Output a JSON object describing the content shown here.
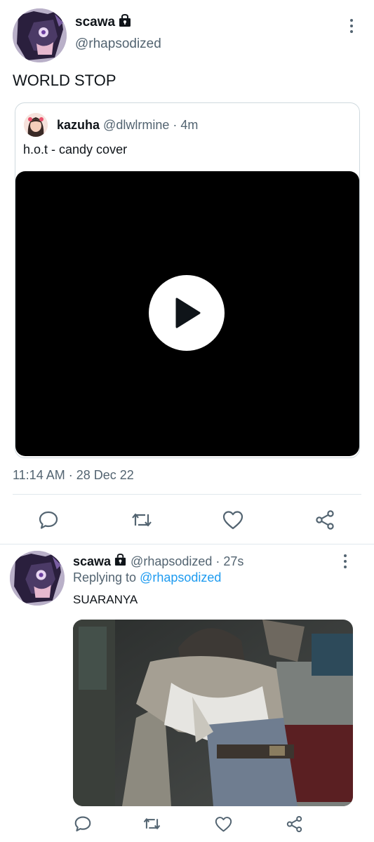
{
  "main_tweet": {
    "display_name": "scawa",
    "handle": "@rhapsodized",
    "text": "WORLD STOP",
    "timestamp": "11:14 AM · 28 Dec 22",
    "quoted": {
      "display_name": "kazuha",
      "handle": "@dlwlrmine",
      "age": "· 4m",
      "text": "h.o.t - candy cover",
      "media": "video"
    }
  },
  "reply_tweet": {
    "display_name": "scawa",
    "handle": "@rhapsodized",
    "age": "· 27s",
    "replying_prefix": "Replying to",
    "replying_to": "@rhapsodized",
    "text": "SUARANYA",
    "media": "image"
  },
  "icons": [
    "lock-icon",
    "more-icon",
    "reply-icon",
    "retweet-icon",
    "like-icon",
    "share-icon",
    "play-icon"
  ],
  "colors": {
    "link": "#1d9bf0",
    "muted": "#536471",
    "text": "#0f1419",
    "divider": "#e1e8ed"
  }
}
